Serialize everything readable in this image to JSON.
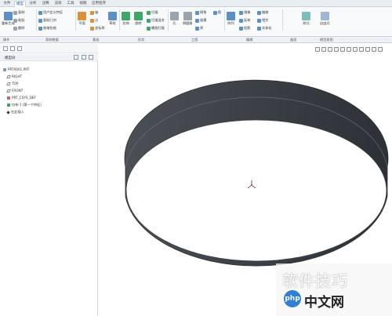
{
  "tabs": [
    "文件",
    "模型",
    "分析",
    "注释",
    "渲染",
    "工具",
    "视图",
    "应用程序"
  ],
  "ribbon": {
    "regenerate": "重新生成",
    "copy": "复制",
    "paste": "粘贴",
    "delete": "删除",
    "user_defined_feature": "用户定义特征",
    "copy_geometry": "复制几何",
    "shrinkwrap": "收缩包络",
    "plane": "平面",
    "axis": "轴",
    "point": "点",
    "coord_system": "坐标系",
    "sketch": "草绘",
    "extrude": "拉伸",
    "revolve": "旋转",
    "sweep": "扫描",
    "swept_blend": "扫描混合",
    "helical_sweep": "螺旋扫描",
    "hole": "孔",
    "round": "倒圆角",
    "chamfer": "倒角",
    "draft": "拔模",
    "shell": "壳",
    "rib": "筋",
    "pattern": "阵列",
    "mirror": "镜像",
    "extend": "延伸",
    "project": "投影",
    "offset": "偏移",
    "intersect": "相交",
    "solidify": "实体化",
    "style": "样式",
    "freestyle": "自由式"
  },
  "groups": [
    "操作",
    "获取数据",
    "基准",
    "形状",
    "工程",
    "编辑",
    "曲面",
    "模型意图"
  ],
  "panel": {
    "title": "模型树",
    "items": [
      {
        "label": "PRT0001.PRT",
        "icon": "part"
      },
      {
        "label": "RIGHT",
        "icon": "plane"
      },
      {
        "label": "TOP",
        "icon": "plane"
      },
      {
        "label": "FRONT",
        "icon": "plane"
      },
      {
        "label": "PRT_CSYS_DEF",
        "icon": "csys"
      },
      {
        "label": "拉伸 1 (第一个特征)",
        "icon": "extrude"
      },
      {
        "label": "在此插入",
        "icon": "insert"
      }
    ]
  },
  "watermark": {
    "text": "软件技巧",
    "logo": "php",
    "site": "中文网"
  },
  "colors": {
    "ribbon_bg": "#f7f9fb",
    "accent": "#1f5fa5",
    "ring_outer": "#40464c",
    "ring_inner": "#2e3338"
  }
}
